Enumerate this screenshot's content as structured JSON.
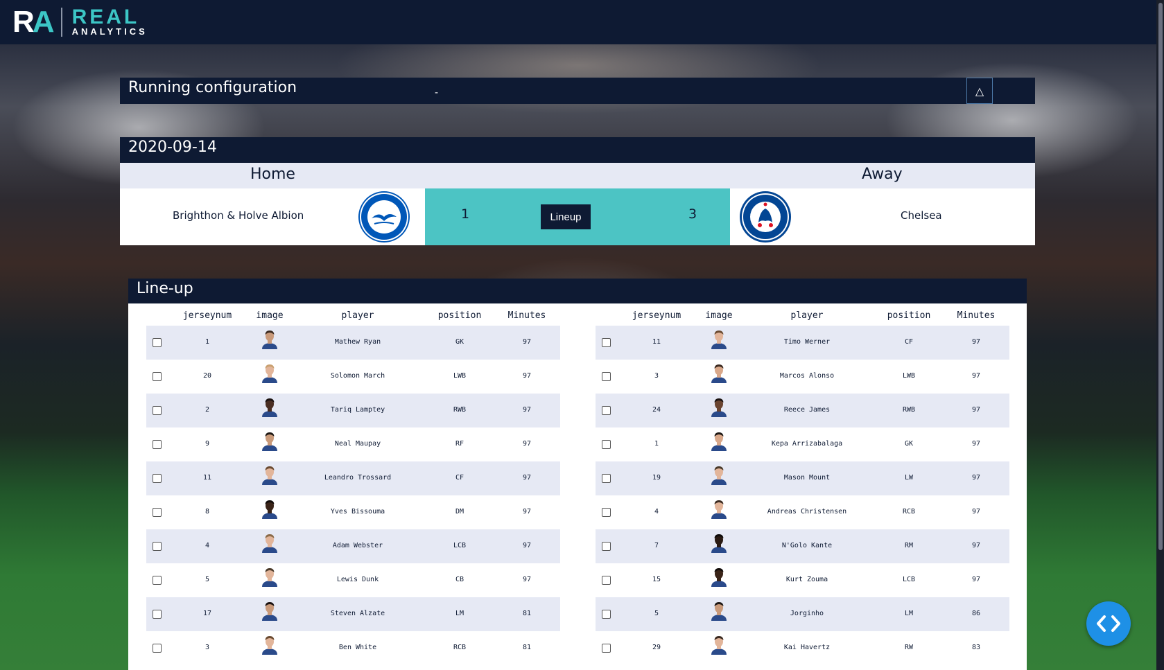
{
  "header": {
    "logo_ra_r": "R",
    "logo_ra_a": "A",
    "logo_real": "REAL",
    "logo_analytics": "ANALYTICS"
  },
  "running_config": {
    "title": "Running configuration",
    "dash": "-",
    "toggle_symbol": "△"
  },
  "match": {
    "date": "2020-09-14",
    "home_label": "Home",
    "away_label": "Away",
    "home_team": "Brighthon & Holve Albion",
    "away_team": "Chelsea",
    "home_score": "1",
    "away_score": "3",
    "lineup_button": "Lineup"
  },
  "lineup": {
    "title": "Line-up",
    "columns": [
      "jerseynum",
      "image",
      "player",
      "position",
      "Minutes"
    ],
    "home": [
      {
        "jerseynum": "1",
        "player": "Mathew Ryan",
        "position": "GK",
        "minutes": "97",
        "skin": "#c99a7a",
        "hair": "#3b2a20"
      },
      {
        "jerseynum": "20",
        "player": "Solomon March",
        "position": "LWB",
        "minutes": "97",
        "skin": "#e2b59a",
        "hair": "#c9a070"
      },
      {
        "jerseynum": "2",
        "player": "Tariq Lamptey",
        "position": "RWB",
        "minutes": "97",
        "skin": "#4a2e22",
        "hair": "#1a1210"
      },
      {
        "jerseynum": "9",
        "player": "Neal Maupay",
        "position": "RF",
        "minutes": "97",
        "skin": "#c99a7a",
        "hair": "#1e1814"
      },
      {
        "jerseynum": "11",
        "player": "Leandro Trossard",
        "position": "CF",
        "minutes": "97",
        "skin": "#e2b59a",
        "hair": "#6a4a30"
      },
      {
        "jerseynum": "8",
        "player": "Yves Bissouma",
        "position": "DM",
        "minutes": "97",
        "skin": "#3a2418",
        "hair": "#120c0a"
      },
      {
        "jerseynum": "4",
        "player": "Adam Webster",
        "position": "LCB",
        "minutes": "97",
        "skin": "#e2b59a",
        "hair": "#8a6a48"
      },
      {
        "jerseynum": "5",
        "player": "Lewis Dunk",
        "position": "CB",
        "minutes": "97",
        "skin": "#e2b59a",
        "hair": "#4a3a2a"
      },
      {
        "jerseynum": "17",
        "player": "Steven Alzate",
        "position": "LM",
        "minutes": "81",
        "skin": "#c99a7a",
        "hair": "#1a1210"
      },
      {
        "jerseynum": "3",
        "player": "Ben White",
        "position": "RCB",
        "minutes": "81",
        "skin": "#e2b59a",
        "hair": "#6a4a30"
      }
    ],
    "away": [
      {
        "jerseynum": "11",
        "player": "Timo Werner",
        "position": "CF",
        "minutes": "97",
        "skin": "#e2b59a",
        "hair": "#6a4a30"
      },
      {
        "jerseynum": "3",
        "player": "Marcos Alonso",
        "position": "LWB",
        "minutes": "97",
        "skin": "#d9a88a",
        "hair": "#3b2a20"
      },
      {
        "jerseynum": "24",
        "player": "Reece James",
        "position": "RWB",
        "minutes": "97",
        "skin": "#6a4430",
        "hair": "#1a1210"
      },
      {
        "jerseynum": "1",
        "player": "Kepa Arrizabalaga",
        "position": "GK",
        "minutes": "97",
        "skin": "#d9a88a",
        "hair": "#1e1814"
      },
      {
        "jerseynum": "19",
        "player": "Mason Mount",
        "position": "LW",
        "minutes": "97",
        "skin": "#e2b59a",
        "hair": "#4a3a2a"
      },
      {
        "jerseynum": "4",
        "player": "Andreas Christensen",
        "position": "RCB",
        "minutes": "97",
        "skin": "#e2b59a",
        "hair": "#3b2a20"
      },
      {
        "jerseynum": "7",
        "player": "N'Golo Kante",
        "position": "RM",
        "minutes": "97",
        "skin": "#2a1a12",
        "hair": "#0e0a08"
      },
      {
        "jerseynum": "15",
        "player": "Kurt Zouma",
        "position": "LCB",
        "minutes": "97",
        "skin": "#3a2418",
        "hair": "#120c0a"
      },
      {
        "jerseynum": "5",
        "player": "Jorginho",
        "position": "LM",
        "minutes": "86",
        "skin": "#c99a7a",
        "hair": "#1e1814"
      },
      {
        "jerseynum": "29",
        "player": "Kai Havertz",
        "position": "RW",
        "minutes": "83",
        "skin": "#e2b59a",
        "hair": "#3b2a20"
      }
    ]
  },
  "colors": {
    "navy": "#0e1a33",
    "teal": "#4cc4c4",
    "row_alt": "#e6e9f4",
    "fab": "#1e90e6"
  },
  "icons": {
    "fab": "code-arrows-icon",
    "toggle": "collapse-triangle-icon"
  }
}
